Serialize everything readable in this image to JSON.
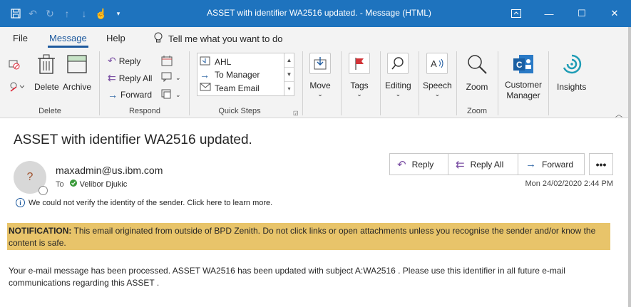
{
  "window": {
    "title": "ASSET with identifier WA2516 updated.  -  Message (HTML)",
    "controls": {
      "minimize": "—",
      "restore": "❐",
      "maximize": "☐",
      "close": "✕"
    }
  },
  "tabs": [
    "File",
    "Message",
    "Help"
  ],
  "tell_me": "Tell me what you want to do",
  "ribbon": {
    "delete_group": {
      "label": "Delete",
      "delete": "Delete",
      "archive": "Archive"
    },
    "respond_group": {
      "label": "Respond",
      "reply": "Reply",
      "reply_all": "Reply All",
      "forward": "Forward"
    },
    "quick_steps": {
      "label": "Quick Steps",
      "items": [
        "AHL",
        "To Manager",
        "Team Email"
      ]
    },
    "move": "Move",
    "tags": "Tags",
    "editing": "Editing",
    "speech": "Speech",
    "zoom_group": {
      "label": "Zoom",
      "zoom": "Zoom"
    },
    "customer_manager": {
      "line1": "Customer",
      "line2": "Manager"
    },
    "insights": "Insights"
  },
  "message": {
    "subject": "ASSET with identifier WA2516 updated.",
    "avatar_initial": "?",
    "sender": "maxadmin@us.ibm.com",
    "to_label": "To",
    "recipient": "Velibor Djukic",
    "date": "Mon 24/02/2020 2:44 PM",
    "verify_notice": "We could not verify the identity of the sender. Click here to learn more.",
    "actions": {
      "reply": "Reply",
      "reply_all": "Reply All",
      "forward": "Forward",
      "more": "•••"
    },
    "notification_label": "NOTIFICATION:",
    "notification_text": " This email originated from outside of BPD Zenith. Do not click links or open attachments unless you recognise the sender and/or know the content is safe.",
    "body": "Your e-mail message has been processed. ASSET WA2516 has been updated with subject A:WA2516 . Please use this identifier in all future e-mail communications regarding this ASSET ."
  },
  "colors": {
    "titlebar": "#1e73be",
    "accent": "#1e5a9e",
    "notification_bg": "#e8c46a"
  }
}
